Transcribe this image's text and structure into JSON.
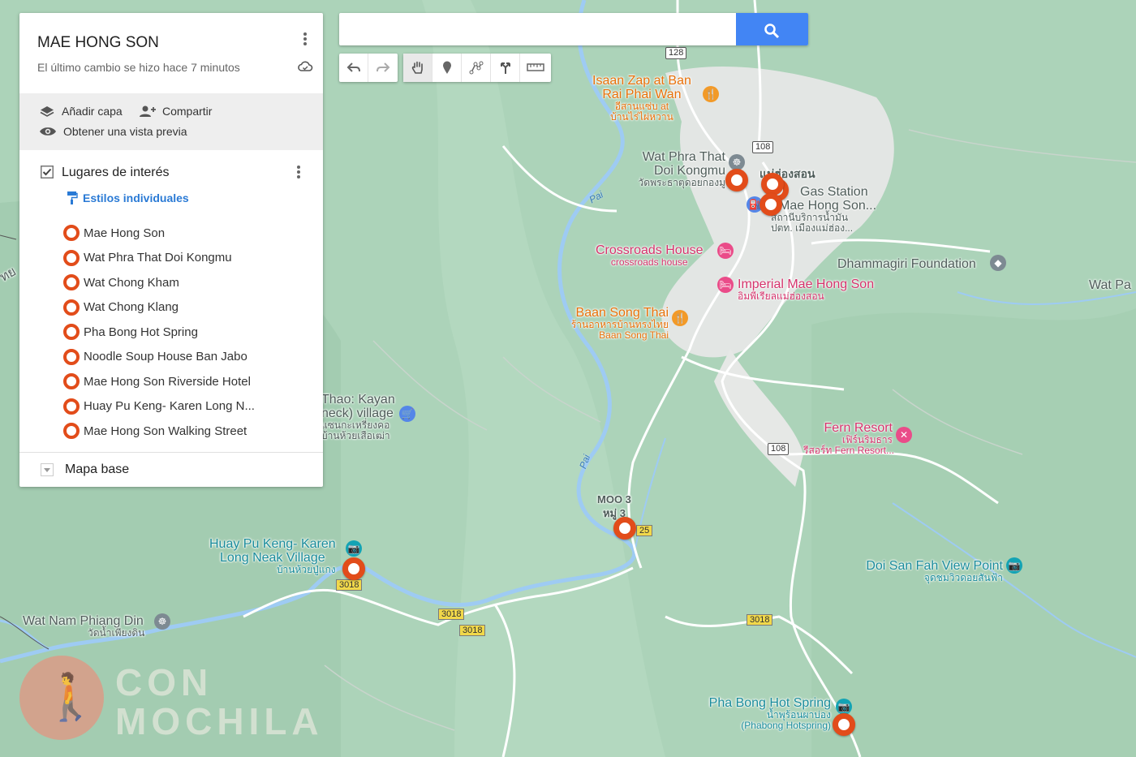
{
  "panel": {
    "title": "MAE HONG SON",
    "subtitle": "El último cambio se hizo hace 7 minutos",
    "add_layer": "Añadir capa",
    "share": "Compartir",
    "preview": "Obtener una vista previa",
    "layer_title": "Lugares de interés",
    "layer_checked": true,
    "style_link": "Estilos individuales",
    "places": [
      "Mae Hong Son",
      "Wat Phra That Doi Kongmu",
      "Wat Chong Kham",
      "Wat Chong Klang",
      "Pha Bong Hot Spring",
      "Noodle Soup House Ban Jabo",
      "Mae Hong Son Riverside Hotel",
      "Huay Pu Keng- Karen Long N...",
      "Mae Hong Son Walking Street"
    ],
    "base_map": "Mapa base"
  },
  "search": {
    "value": "",
    "placeholder": ""
  },
  "toolbar": [
    "undo-icon",
    "redo-icon",
    "hand-icon",
    "marker-icon",
    "line-icon",
    "directions-icon",
    "ruler-icon"
  ],
  "colors": {
    "pin": "#e24c1a",
    "search_button": "#4285f4",
    "map_bg": "#a9d2b6",
    "river": "#9ecbf3"
  },
  "map_labels": {
    "isaan_1": "Isaan Zap at Ban",
    "isaan_2": "Rai Phai Wan",
    "isaan_th1": "อีสานแซ่บ at",
    "isaan_th2": "บ้านไร่ไผ่หวาน",
    "wat_phra_1": "Wat Phra That",
    "wat_phra_2": "Doi Kongmu",
    "wat_phra_th": "วัดพระธาตุดอยกองมู",
    "town_th": "แม่ฮ่องสอน",
    "gas_1": "Gas Station",
    "gas_2": "Mae Hong Son...",
    "gas_th1": "สถานีบริการน้ำมัน",
    "gas_th2": "ปตท. เมืองแม่ฮ่อง...",
    "crossroads": "Crossroads House",
    "crossroads_sub": "crossroads house",
    "dhammagiri": "Dhammagiri Foundation",
    "wat_pa": "Wat Pa",
    "imperial": "Imperial Mae Hong Son",
    "imperial_th": "อิมพีเรียลแม่ฮ่องสอน",
    "baan_1": "Baan Song Thai",
    "baan_th": "ร้านอาหารบ้านทรงไทย",
    "baan_2": "Baan Song Thai",
    "kayan_1": "Thao: Kayan",
    "kayan_2": "neck) village",
    "kayan_th1": "แซนกะเหรี่ยงคอ",
    "kayan_th2": "บ้านห้วยเสือเฒ่า",
    "fern": "Fern Resort",
    "fern_th": "เฟิร์นริมธาร",
    "fern_th2": "รีสอร์ท Fern Resort...",
    "moo": "MOO 3",
    "moo_th": "หมู่ 3",
    "huay_1": "Huay Pu Keng- Karen",
    "huay_2": "Long Neak Village",
    "huay_th": "บ้านห้วยปู่แกง",
    "doi_san_1": "Doi San Fah View Point",
    "doi_san_th": "จุดชมวิวดอยสันฟ้า",
    "wat_nam_1": "Wat Nam Phiang Din",
    "wat_nam_th": "วัดน้ำเพียงดิน",
    "pha_bong_1": "Pha Bong Hot Spring",
    "pha_bong_th": "น้ำพุร้อนผาบ่อง",
    "pha_bong_2": "(Phabong Hotspring)",
    "river_pai": "Pai",
    "side_cut": "ทย"
  },
  "road_shields": {
    "r128": "128",
    "r108a": "108",
    "r108b": "108",
    "r3018a": "3018",
    "r3018b": "3018",
    "r3018c": "3018",
    "r3018d": "3018",
    "r25": "25"
  },
  "watermark": {
    "line1": "CON",
    "line2": "MOCHILA"
  }
}
